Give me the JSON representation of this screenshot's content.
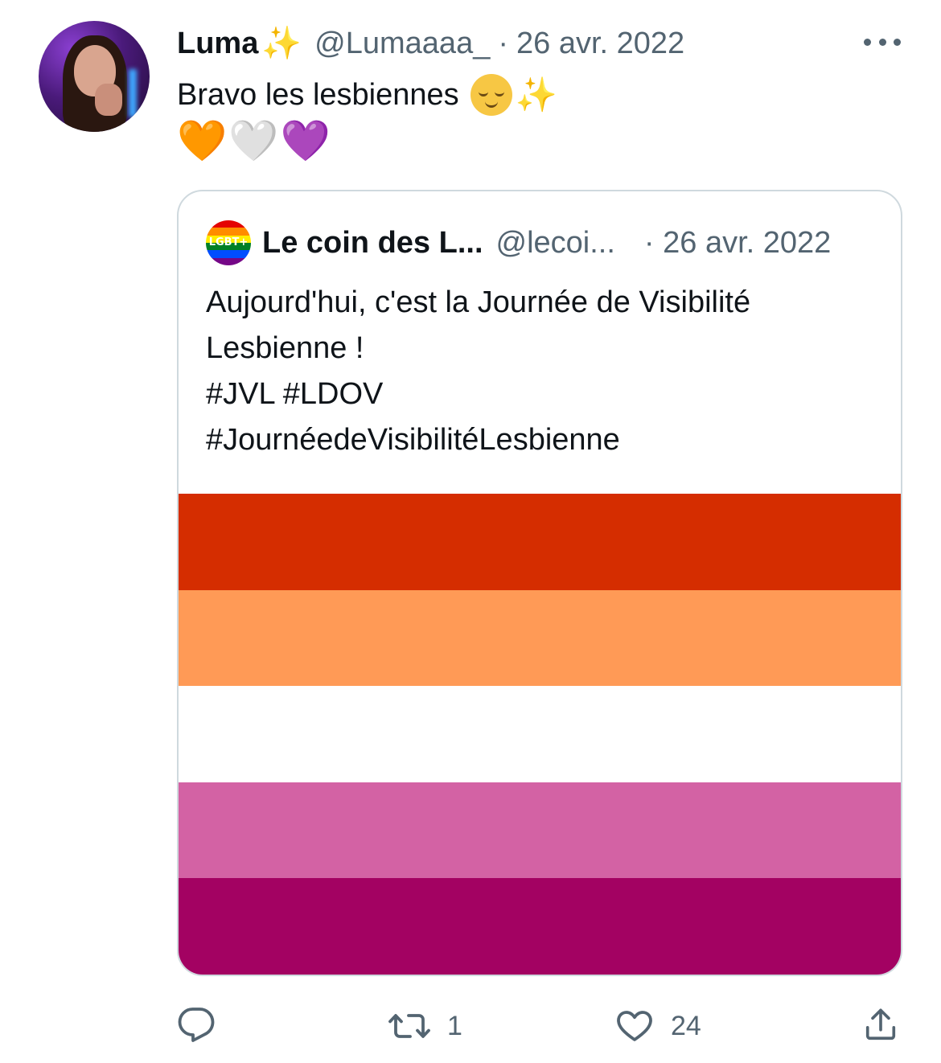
{
  "tweet": {
    "author_name": "Luma",
    "name_emoji": "✨",
    "handle": "@Lumaaaa_",
    "separator": "·",
    "date": "26 avr. 2022",
    "text": "Bravo les lesbiennes",
    "text_emoji_2": "✨",
    "hearts": [
      "🧡",
      "🤍",
      "💜"
    ]
  },
  "quoted": {
    "avatar_label": "LGBT+",
    "author_name": "Le coin des L...",
    "handle": "@lecoi...",
    "separator": "·",
    "date": "26 avr. 2022",
    "lines": [
      "Aujourd'hui, c'est la Journée de Visibilité",
      "Lesbienne !",
      "#JVL #LDOV",
      "#JournéedeVisibilitéLesbienne"
    ],
    "flag_colors": [
      "#d52d00",
      "#ff9a56",
      "#ffffff",
      "#d362a4",
      "#a30262"
    ]
  },
  "actions": {
    "reply_count": "",
    "retweet_count": "1",
    "like_count": "24"
  },
  "colors": {
    "text": "#0f1419",
    "secondary": "#536471",
    "border": "#cfd9de"
  }
}
